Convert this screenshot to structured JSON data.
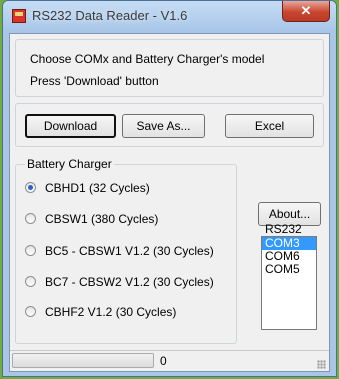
{
  "window": {
    "title": "RS232 Data Reader - V1.6",
    "close_glyph": "✕"
  },
  "instructions": {
    "line1": "Choose COMx and Battery Charger's model",
    "line2": "Press 'Download' button"
  },
  "buttons": {
    "download": "Download",
    "save_as": "Save As...",
    "excel": "Excel",
    "about": "About..."
  },
  "battery_charger": {
    "title": "Battery Charger",
    "selected_index": 0,
    "options": [
      "CBHD1 (32 Cycles)",
      "CBSW1 (380 Cycles)",
      "BC5 - CBSW1 V1.2 (30 Cycles)",
      "BC7 - CBSW2 V1.2 (30 Cycles)",
      "CBHF2 V1.2 (30 Cycles)"
    ]
  },
  "rs232": {
    "label": "RS232",
    "ports": [
      "COM3",
      "COM6",
      "COM5"
    ],
    "selected": "COM3"
  },
  "status": {
    "progress_fraction": 0,
    "count": "0"
  },
  "colors": {
    "progress_fill": "#37c83b",
    "selection": "#3399ff",
    "close_button": "#c84631"
  }
}
